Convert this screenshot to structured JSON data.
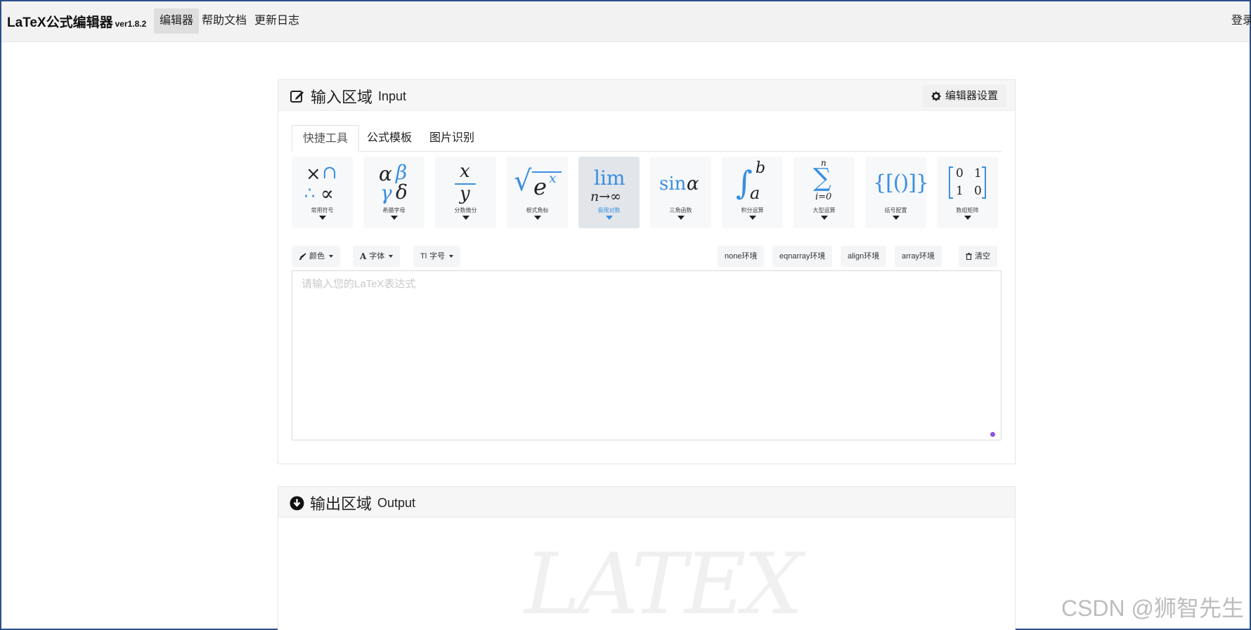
{
  "navbar": {
    "brand": "LaTeX公式编辑器",
    "version": "ver1.8.2",
    "items": [
      "编辑器",
      "帮助文档",
      "更新日志"
    ],
    "active_index": 0,
    "login": "登录"
  },
  "input_panel": {
    "title_zh": "输入区域",
    "title_en": "Input",
    "settings_label": "编辑器设置",
    "tabs": [
      "快捷工具",
      "公式模板",
      "图片识别"
    ],
    "active_tab": 0,
    "tools": [
      {
        "label": "常用符号",
        "icon": "common-symbols"
      },
      {
        "label": "希腊字母",
        "icon": "greek-letters"
      },
      {
        "label": "分数微分",
        "icon": "fraction"
      },
      {
        "label": "根式角标",
        "icon": "radical-script"
      },
      {
        "label": "极限对数",
        "icon": "limit-log",
        "active": true
      },
      {
        "label": "三角函数",
        "icon": "trig-function"
      },
      {
        "label": "积分运算",
        "icon": "integral"
      },
      {
        "label": "大型运算",
        "icon": "large-operator"
      },
      {
        "label": "括号配置",
        "icon": "brackets"
      },
      {
        "label": "数组矩阵",
        "icon": "matrix"
      }
    ],
    "glyphs": {
      "common": {
        "a": "×",
        "b": "∩",
        "c": "∴",
        "d": "∝"
      },
      "greek": {
        "a": "α",
        "b": "β",
        "c": "γ",
        "d": "δ"
      },
      "fraction": {
        "num": "x",
        "den": "y"
      },
      "radical": {
        "sign": "√",
        "base": "e",
        "sup": "x"
      },
      "limit": {
        "op": "lim",
        "sub": "n→∞"
      },
      "trig": {
        "fn": "sin",
        "arg": "α"
      },
      "integral": {
        "sign": "∫",
        "upper": "b",
        "lower": "a"
      },
      "sum": {
        "sign": "∑",
        "upper": "n",
        "lower": "i=0"
      },
      "brackets": {
        "text": "{[()]}"
      },
      "matrix": {
        "cells": [
          "0",
          "1",
          "1",
          "0"
        ]
      }
    },
    "format_buttons": [
      {
        "label": "颜色",
        "icon": "paintbrush-icon"
      },
      {
        "label": "字体",
        "icon": "font-icon"
      },
      {
        "label": "字号",
        "icon": "text-size-icon"
      }
    ],
    "env_buttons": [
      "none环境",
      "eqnarray环境",
      "align环境",
      "array环境"
    ],
    "clear_label": "清空",
    "editor_placeholder": "请输入您的LaTeX表达式",
    "editor_value": ""
  },
  "output_panel": {
    "title_zh": "输出区域",
    "title_en": "Output",
    "watermark": "LATEX"
  },
  "csdn_watermark": "CSDN @狮智先生",
  "colors": {
    "accent": "#3a8fe0",
    "resize_dot": "#8a55e0"
  }
}
